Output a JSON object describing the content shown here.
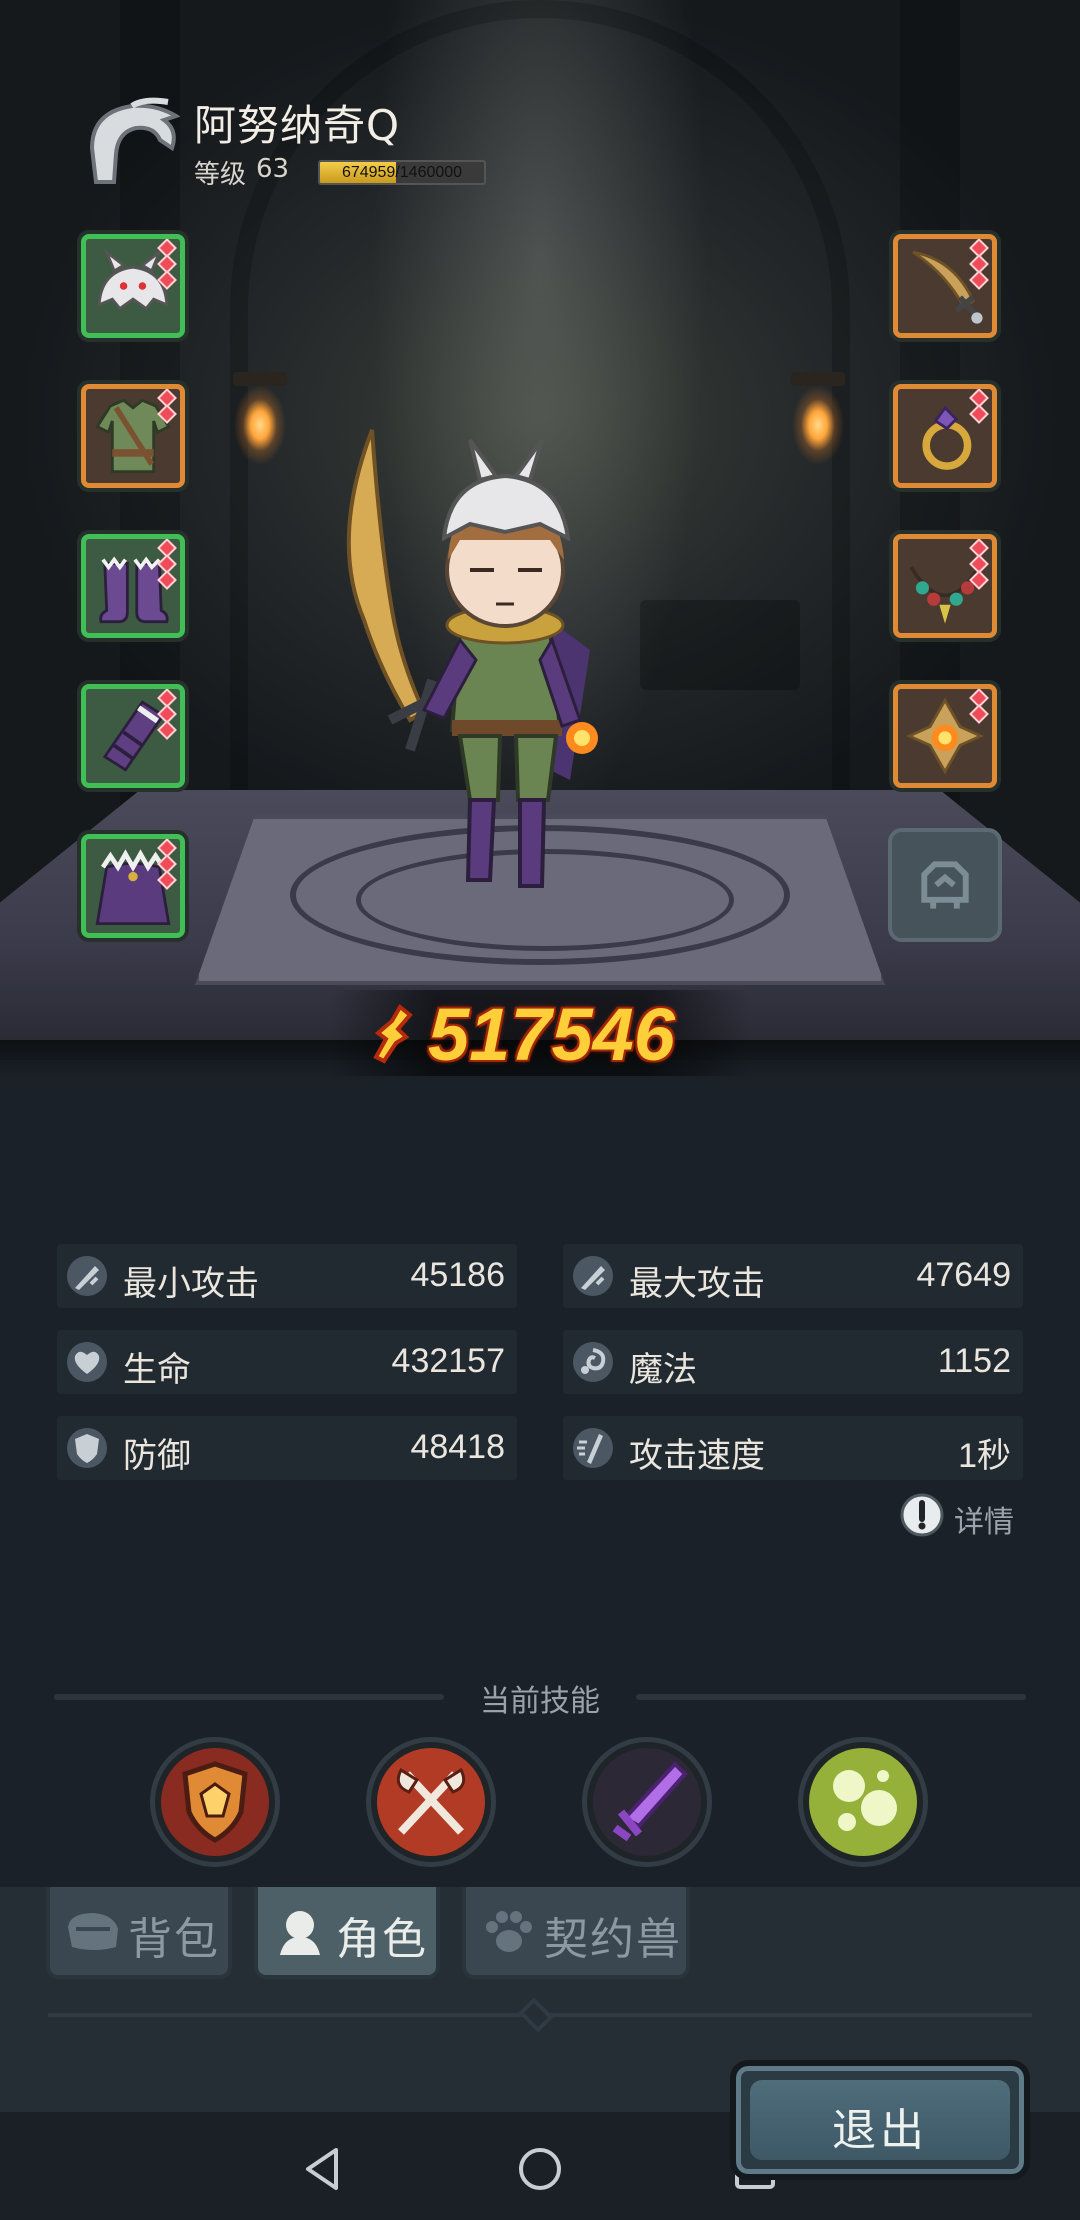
{
  "player": {
    "name": "阿努纳奇Q",
    "level_label": "等级",
    "level": "63",
    "exp_text": "674959/1460000",
    "exp_fraction": 0.462
  },
  "equipment": {
    "left": [
      {
        "icon": "helmet-icon",
        "rarity": "green"
      },
      {
        "icon": "armor-icon",
        "rarity": "orange"
      },
      {
        "icon": "boots-icon",
        "rarity": "green"
      },
      {
        "icon": "gauntlet-icon",
        "rarity": "green"
      },
      {
        "icon": "cape-icon",
        "rarity": "green"
      }
    ],
    "right": [
      {
        "icon": "sword-icon",
        "rarity": "orange"
      },
      {
        "icon": "ring-icon",
        "rarity": "orange"
      },
      {
        "icon": "necklace-icon",
        "rarity": "orange"
      },
      {
        "icon": "amulet-icon",
        "rarity": "orange"
      },
      {
        "icon": "pet-slot-icon",
        "rarity": "empty"
      }
    ]
  },
  "power": {
    "value": "517546"
  },
  "stats": {
    "min_attack": {
      "label": "最小攻击",
      "value": "45186"
    },
    "max_attack": {
      "label": "最大攻击",
      "value": "47649"
    },
    "hp": {
      "label": "生命",
      "value": "432157"
    },
    "mana": {
      "label": "魔法",
      "value": "1152"
    },
    "defense": {
      "label": "防御",
      "value": "48418"
    },
    "attack_speed": {
      "label": "攻击速度",
      "value": "1秒"
    },
    "details_label": "详情"
  },
  "skills": {
    "title": "当前技能",
    "items": [
      "shield-skill-icon",
      "crossed-axes-skill-icon",
      "purple-blade-skill-icon",
      "green-orbs-skill-icon"
    ]
  },
  "tabs": {
    "bag": "背包",
    "character": "角色",
    "pet": "契约兽"
  },
  "exit_label": "退出",
  "colors": {
    "rarity_green": "#3fbf55",
    "rarity_orange": "#e08a35",
    "power_gold": "#ffcf3a"
  }
}
